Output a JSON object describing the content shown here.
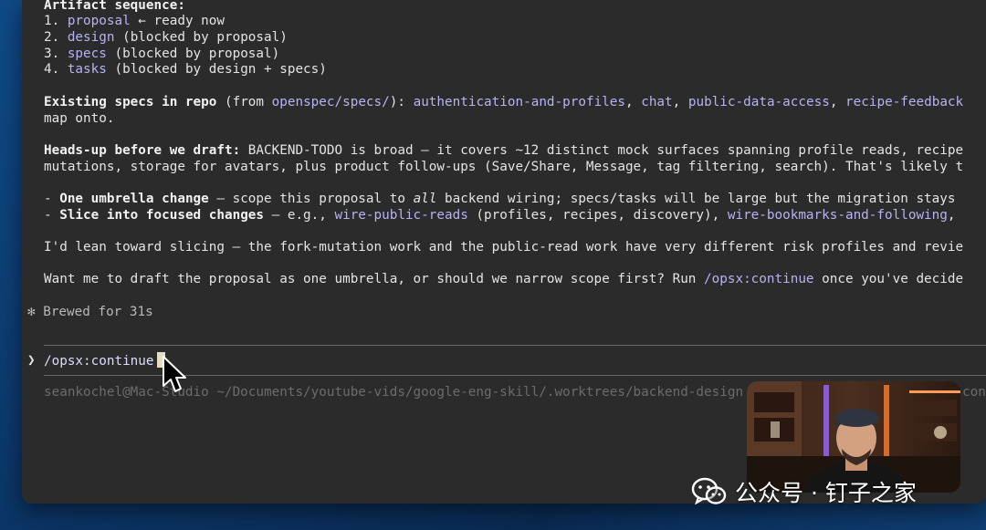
{
  "terminal": {
    "section_artifact_heading": "Artifact sequence:",
    "artifacts": [
      {
        "num": "1.",
        "name": "proposal",
        "status": " ← ready now"
      },
      {
        "num": "2.",
        "name": "design",
        "status": " (blocked by proposal)"
      },
      {
        "num": "3.",
        "name": "specs",
        "status": " (blocked by proposal)"
      },
      {
        "num": "4.",
        "name": "tasks",
        "status": " (blocked by design + specs)"
      }
    ],
    "existing": {
      "heading": "Existing specs in repo",
      "from_pre": " (from ",
      "path": "openspec/specs/",
      "from_post": "): ",
      "spec1": "authentication-and-profiles",
      "spec2": "chat",
      "spec3": "public-data-access",
      "spec4": "recipe-feedback",
      "sep": ", ",
      "line2": "map onto."
    },
    "headsup": {
      "heading": "Heads-up before we draft:",
      "line1_rest": " BACKEND-TODO is broad — it covers ~12 distinct mock surfaces spanning profile reads, recipe",
      "line2": "mutations, storage for avatars, plus product follow-ups (Save/Share, Message, tag filtering, search). That's likely t"
    },
    "options": {
      "dash": "- ",
      "opt1_bold": "One umbrella change",
      "opt1_pre": " — scope this proposal to ",
      "opt1_ital": "all",
      "opt1_post": " backend wiring; specs/tasks will be large but the migration stays",
      "opt2_bold": "Slice into focused changes",
      "opt2_pre": " — e.g., ",
      "opt2_link1": "wire-public-reads",
      "opt2_mid": " (profiles, recipes, discovery), ",
      "opt2_link2": "wire-bookmarks-and-following",
      "opt2_post": ","
    },
    "lean": "I'd lean toward slicing — the fork-mutation work and the public-read work have very different risk profiles and revie",
    "ask": {
      "pre": "Want me to draft the proposal as one umbrella, or should we narrow scope first? Run ",
      "cmd": "/opsx:continue",
      "post": " once you've decide"
    },
    "brewed": {
      "star": "✻",
      "text": " Brewed for 31s"
    },
    "prompt": {
      "arrow": "❯",
      "input": "/opsx:continue"
    },
    "statusline": "seankochel@Mac-Studio ~/Documents/youtube-vids/google-eng-skill/.worktrees/backend-design",
    "statusline_tail": "con"
  },
  "watermark": {
    "text": "公众号 · 钉子之家",
    "icon": "wechat-icon"
  },
  "colors": {
    "link": "#b6b3f2",
    "terminal_bg": "#2b2b2b",
    "caret": "#e6dcc0"
  }
}
